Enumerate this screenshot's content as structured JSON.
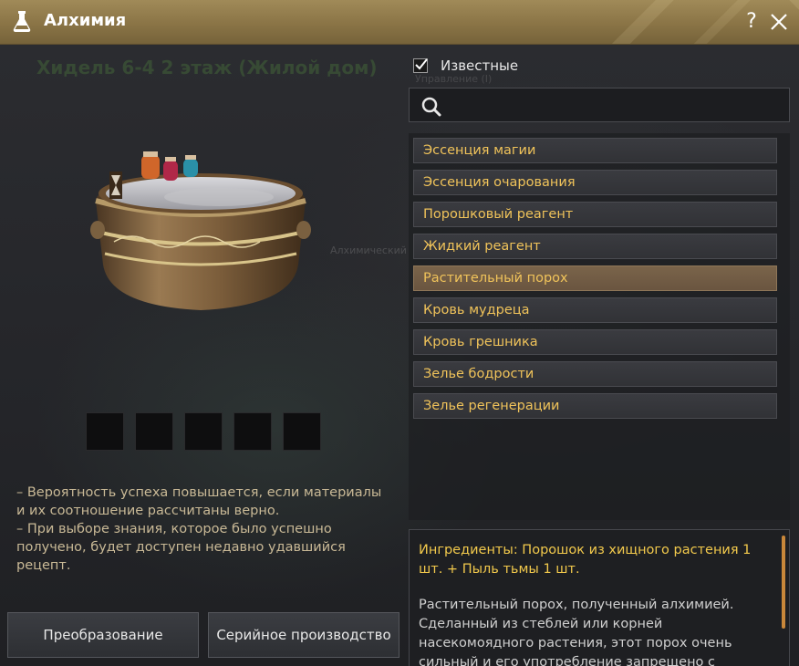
{
  "window": {
    "title": "Алхимия",
    "help_label": "?",
    "title_icon": "flask-icon",
    "close_icon": "close-icon"
  },
  "background": {
    "location_title": "Хидель 6-4 2 этаж (Жилой дом)",
    "ghost_label_1": "Управление (I)",
    "ghost_label_2": "Алхимический"
  },
  "preview": {
    "image": "alchemy-cauldron-image",
    "slot_count": 5
  },
  "hint": {
    "line1": "– Вероятность успеха повышается, если материалы и их соотношение рассчитаны верно.",
    "line2": "– При выборе знания, которое было успешно получено, будет доступен недавно удавшийся рецепт."
  },
  "buttons": {
    "transform": "Преобразование",
    "serial": "Серийное производство"
  },
  "filter": {
    "known_label": "Известные",
    "known_checked": true
  },
  "search": {
    "placeholder": "",
    "value": ""
  },
  "recipes": {
    "items": [
      {
        "label": "Эссенция магии"
      },
      {
        "label": "Эссенция очарования"
      },
      {
        "label": "Порошковый реагент"
      },
      {
        "label": "Жидкий реагент"
      },
      {
        "label": "Растительный порох"
      },
      {
        "label": "Кровь мудреца"
      },
      {
        "label": "Кровь грешника"
      },
      {
        "label": "Зелье бодрости"
      },
      {
        "label": "Зелье регенерации"
      }
    ],
    "selected_index": 4
  },
  "description": {
    "ingredients": "Ингредиенты: Порошок из хищного растения 1 шт. + Пыль тьмы 1 шт.",
    "body": "Растительный порох, полученный алхимией. Сделанный из стеблей или корней насекомоядного растения, этот порох очень сильный и его употребление запрещено с древних"
  },
  "colors": {
    "header": "#8a7446",
    "item_text": "#f0c35a",
    "selected_item": "#6e5a44",
    "ingredients_text": "#f2c94c",
    "scrollbar": "#c8873a"
  }
}
